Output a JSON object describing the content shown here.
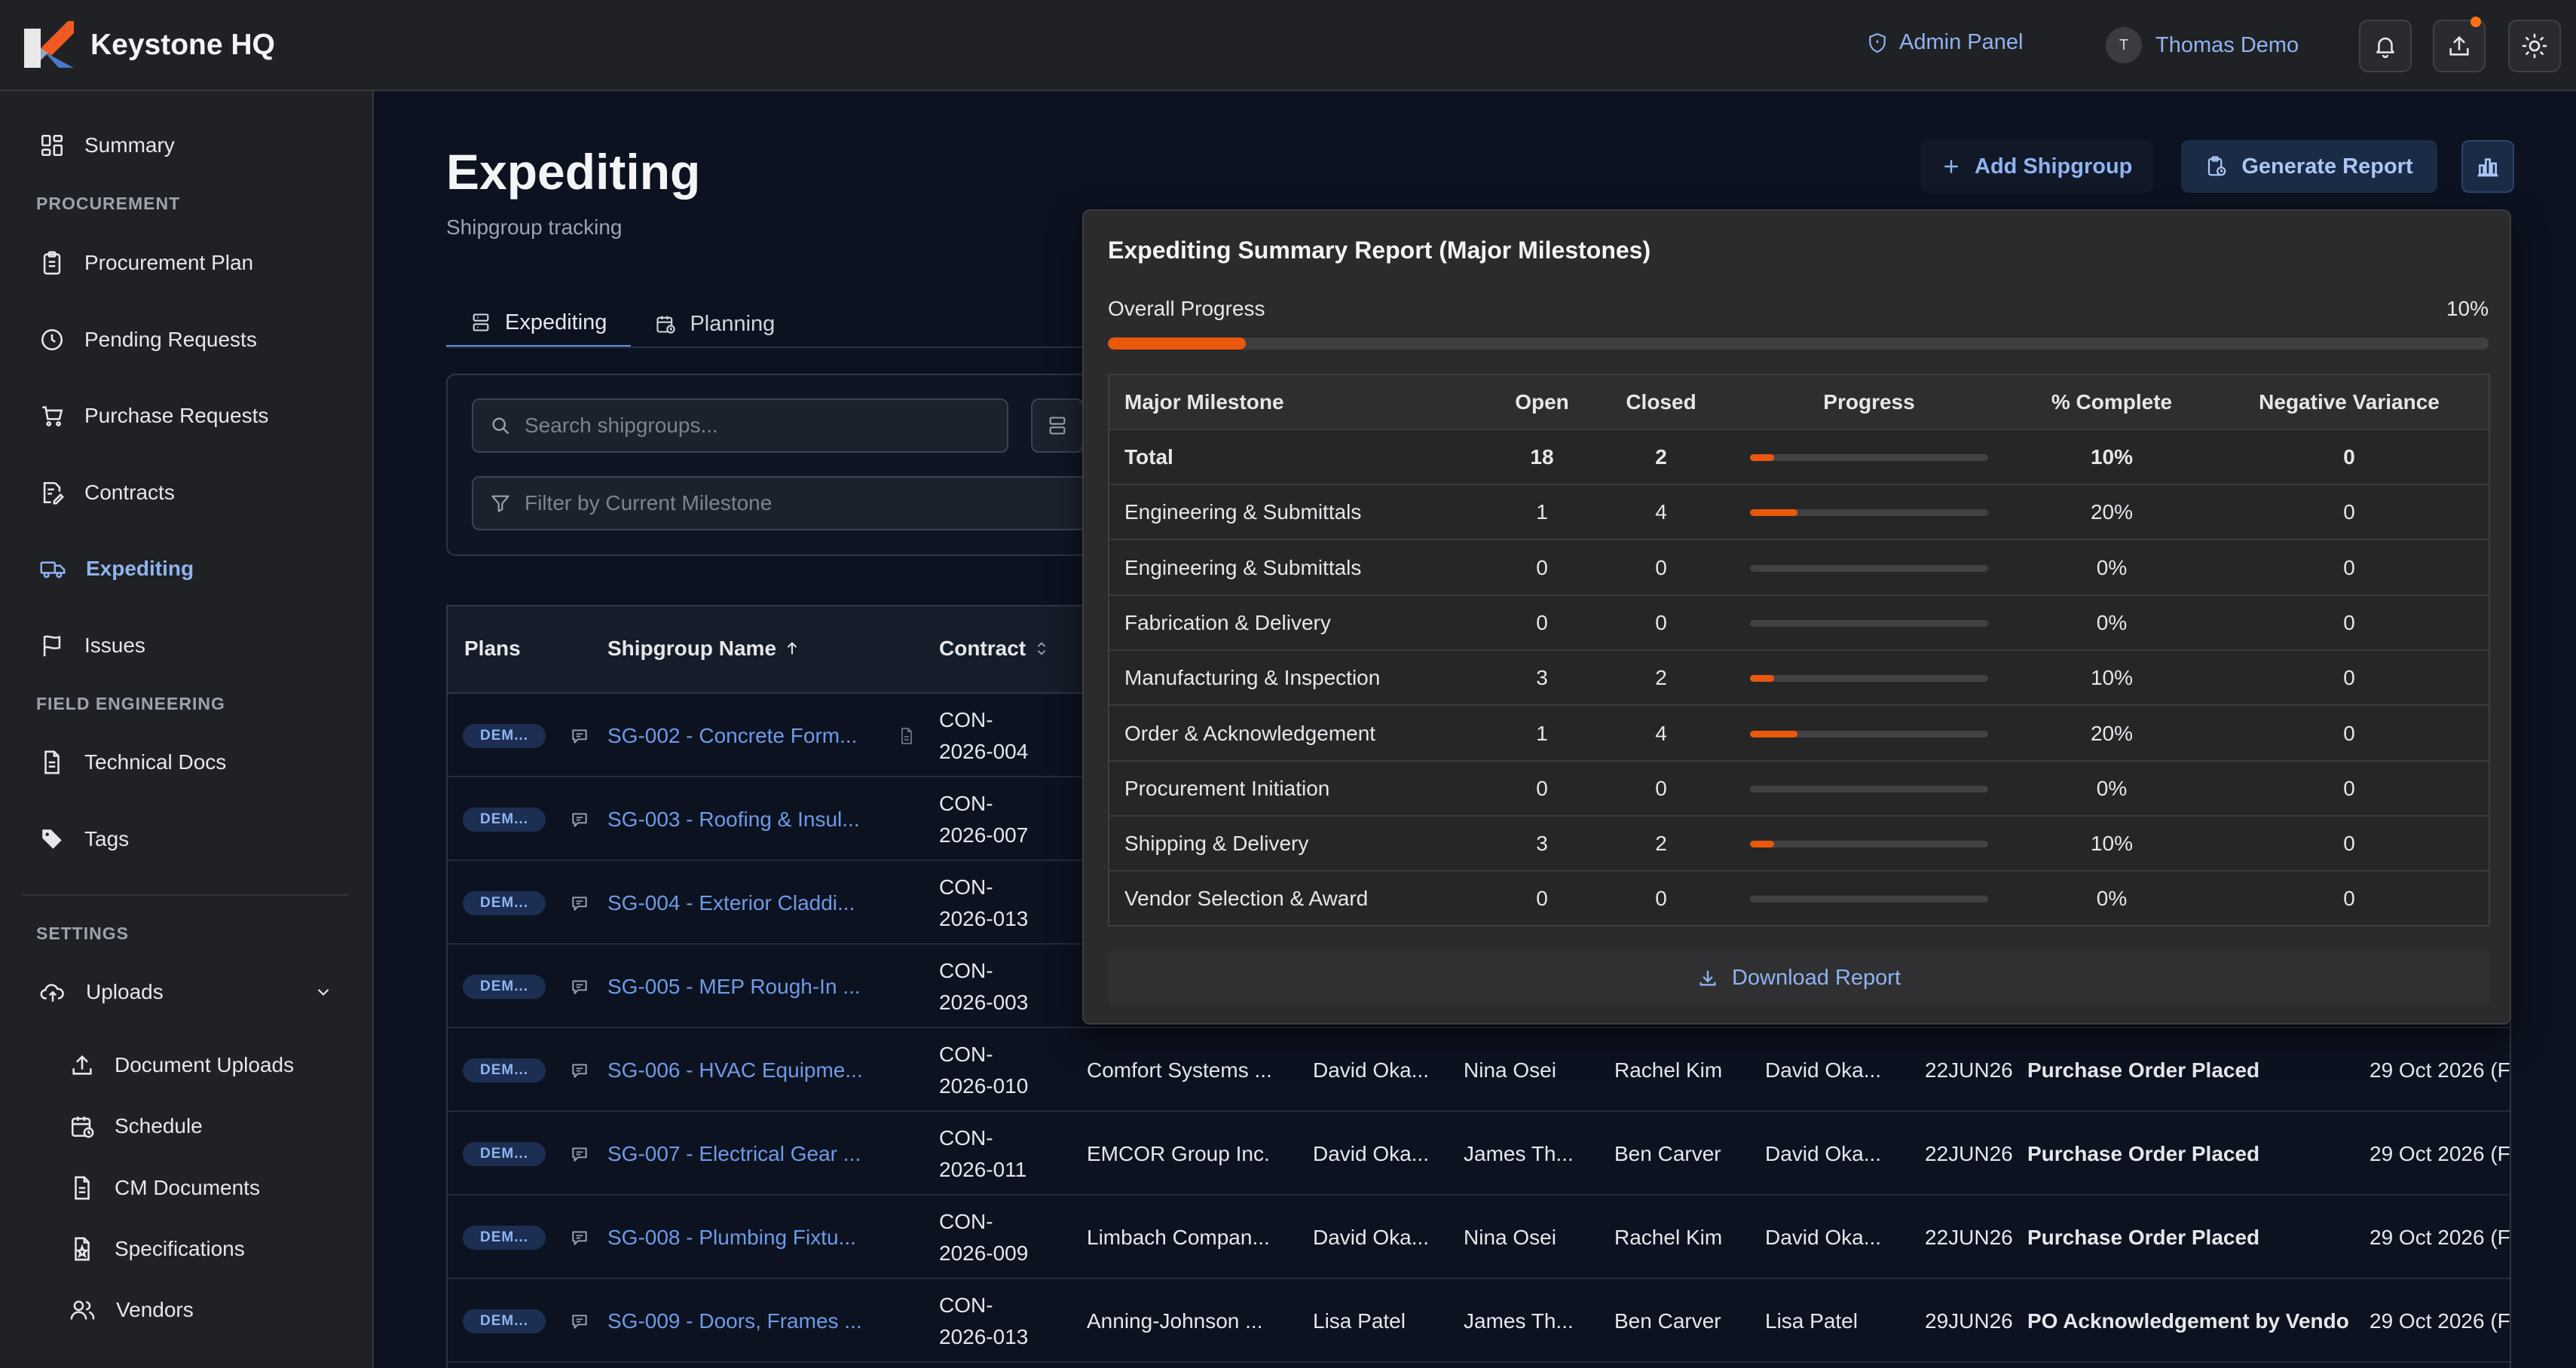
{
  "app": {
    "title": "Keystone HQ"
  },
  "topbar": {
    "admin_label": "Admin Panel",
    "user_initial": "T",
    "user_name": "Thomas Demo"
  },
  "sidebar": {
    "summary": "Summary",
    "procurement_section": "PROCUREMENT",
    "procurement_plan": "Procurement Plan",
    "pending_requests": "Pending Requests",
    "purchase_requests": "Purchase Requests",
    "contracts": "Contracts",
    "expediting": "Expediting",
    "issues": "Issues",
    "field_section": "FIELD ENGINEERING",
    "technical_docs": "Technical Docs",
    "tags": "Tags",
    "settings_section": "SETTINGS",
    "uploads": "Uploads",
    "document_uploads": "Document Uploads",
    "schedule": "Schedule",
    "cm_documents": "CM Documents",
    "specifications": "Specifications",
    "vendors": "Vendors"
  },
  "page": {
    "title": "Expediting",
    "subtitle": "Shipgroup tracking"
  },
  "actions": {
    "add_shipgroup": "Add Shipgroup",
    "generate_report": "Generate Report"
  },
  "tabs": {
    "expediting": "Expediting",
    "planning": "Planning"
  },
  "filters": {
    "search_placeholder": "Search shipgroups...",
    "milestone_placeholder": "Filter by Current Milestone"
  },
  "grid": {
    "headers": {
      "plans": "Plans",
      "shipgroup_name": "Shipgroup Name",
      "contract": "Contract"
    },
    "rows": [
      {
        "badge": "DEM...",
        "name": "SG-002 - Concrete Form...",
        "contract_a": "CON-",
        "contract_b": "2026-004"
      },
      {
        "badge": "DEM...",
        "name": "SG-003 - Roofing & Insul...",
        "contract_a": "CON-",
        "contract_b": "2026-007"
      },
      {
        "badge": "DEM...",
        "name": "SG-004 - Exterior Claddi...",
        "contract_a": "CON-",
        "contract_b": "2026-013"
      },
      {
        "badge": "DEM...",
        "name": "SG-005 - MEP Rough-In ...",
        "contract_a": "CON-",
        "contract_b": "2026-003"
      },
      {
        "badge": "DEM...",
        "name": "SG-006 - HVAC Equipme...",
        "contract_a": "CON-",
        "contract_b": "2026-010",
        "vendor": "Comfort Systems ...",
        "p1": "David Oka...",
        "p2": "Nina Osei",
        "p3": "Rachel Kim",
        "p4": "David Oka...",
        "date": "22JUN26",
        "milestone": "Purchase Order Placed",
        "due": "29 Oct 2026 (F"
      },
      {
        "badge": "DEM...",
        "name": "SG-007 - Electrical Gear ...",
        "contract_a": "CON-",
        "contract_b": "2026-011",
        "vendor": "EMCOR Group Inc.",
        "p1": "David Oka...",
        "p2": "James Th...",
        "p3": "Ben Carver",
        "p4": "David Oka...",
        "date": "22JUN26",
        "milestone": "Purchase Order Placed",
        "due": "29 Oct 2026 (F"
      },
      {
        "badge": "DEM...",
        "name": "SG-008 - Plumbing Fixtu...",
        "contract_a": "CON-",
        "contract_b": "2026-009",
        "vendor": "Limbach Compan...",
        "p1": "David Oka...",
        "p2": "Nina Osei",
        "p3": "Rachel Kim",
        "p4": "David Oka...",
        "date": "22JUN26",
        "milestone": "Purchase Order Placed",
        "due": "29 Oct 2026 (F"
      },
      {
        "badge": "DEM...",
        "name": "SG-009 - Doors, Frames ...",
        "contract_a": "CON-",
        "contract_b": "2026-013",
        "vendor": "Anning-Johnson ...",
        "p1": "Lisa Patel",
        "p2": "James Th...",
        "p3": "Ben Carver",
        "p4": "Lisa Patel",
        "date": "29JUN26",
        "milestone": "PO Acknowledgement by Vendo",
        "due": "29 Oct 2026 (F"
      }
    ]
  },
  "report": {
    "title": "Expediting Summary Report (Major Milestones)",
    "overall_label": "Overall Progress",
    "overall_value": "10%",
    "overall_pct": 10,
    "headers": {
      "milestone": "Major Milestone",
      "open": "Open",
      "closed": "Closed",
      "progress": "Progress",
      "pct": "% Complete",
      "neg": "Negative Variance"
    },
    "rows": [
      {
        "milestone": "Total",
        "open": "18",
        "closed": "2",
        "pct": "10%",
        "neg": "0",
        "fill": 10,
        "bold": true
      },
      {
        "milestone": "Engineering & Submittals",
        "open": "1",
        "closed": "4",
        "pct": "20%",
        "neg": "0",
        "fill": 20
      },
      {
        "milestone": "Engineering & Submittals",
        "open": "0",
        "closed": "0",
        "pct": "0%",
        "neg": "0",
        "fill": 0
      },
      {
        "milestone": "Fabrication & Delivery",
        "open": "0",
        "closed": "0",
        "pct": "0%",
        "neg": "0",
        "fill": 0
      },
      {
        "milestone": "Manufacturing & Inspection",
        "open": "3",
        "closed": "2",
        "pct": "10%",
        "neg": "0",
        "fill": 10
      },
      {
        "milestone": "Order & Acknowledgement",
        "open": "1",
        "closed": "4",
        "pct": "20%",
        "neg": "0",
        "fill": 20
      },
      {
        "milestone": "Procurement Initiation",
        "open": "0",
        "closed": "0",
        "pct": "0%",
        "neg": "0",
        "fill": 0
      },
      {
        "milestone": "Shipping & Delivery",
        "open": "3",
        "closed": "2",
        "pct": "10%",
        "neg": "0",
        "fill": 10
      },
      {
        "milestone": "Vendor Selection & Award",
        "open": "0",
        "closed": "0",
        "pct": "0%",
        "neg": "0",
        "fill": 0
      }
    ],
    "download_label": "Download Report"
  },
  "colors": {
    "accent": "#8fb3f0",
    "progress": "#ea580c",
    "brand_orange": "#f15a22",
    "brand_blue": "#4a78c8"
  }
}
